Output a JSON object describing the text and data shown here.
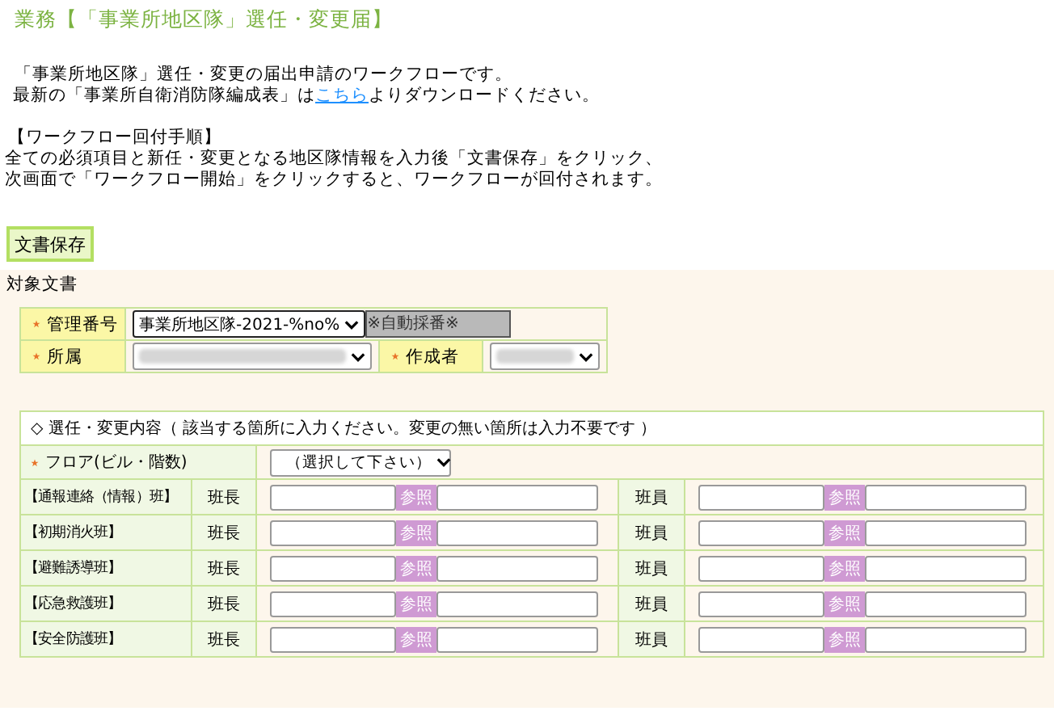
{
  "title": "業務【「事業所地区隊」選任・変更届】",
  "intro": [
    {
      "text": "「事業所地区隊」選任・変更の届出申請のワークフローです。"
    },
    {
      "before": "最新の「事業所自衛消防隊編成表」は",
      "link": "こちら",
      "after": "よりダウンロードください。"
    }
  ],
  "procedure": {
    "heading": "【ワークフロー回付手順】",
    "lines": [
      "全ての必須項目と新任・変更となる地区隊情報を入力後「文書保存」をクリック、",
      "次画面で「ワークフロー開始」をクリックすると、ワークフローが回付されます。"
    ]
  },
  "save_button": "文書保存",
  "section_label": "対象文書",
  "doc_fields": {
    "number": {
      "label": "管理番号",
      "required": true,
      "value": "事業所地区隊-2021-%no%",
      "auto": "※自動採番※"
    },
    "dept": {
      "label": "所属",
      "required": true,
      "redacted": true
    },
    "author": {
      "label": "作成者",
      "required": true,
      "redacted": true
    }
  },
  "changes": {
    "heading": "◇ 選任・変更内容（ 該当する箇所に入力ください。変更の無い箇所は入力不要です ）",
    "floor": {
      "label": "フロア(ビル・階数)",
      "required": true,
      "value": "（選択して下さい）"
    },
    "teams": [
      {
        "name": "【通報連絡（情報）班】",
        "leader_label": "班長",
        "leader_ref": "参照",
        "member_label": "班員",
        "member_ref": "参照"
      },
      {
        "name": "【初期消火班】",
        "leader_label": "班長",
        "leader_ref": "参照",
        "member_label": "班員",
        "member_ref": "参照"
      },
      {
        "name": "【避難誘導班】",
        "leader_label": "班長",
        "leader_ref": "参照",
        "member_label": "班員",
        "member_ref": "参照"
      },
      {
        "name": "【応急救護班】",
        "leader_label": "班長",
        "leader_ref": "参照",
        "member_label": "班員",
        "member_ref": "参照"
      },
      {
        "name": "【安全防護班】",
        "leader_label": "班長",
        "leader_ref": "参照",
        "member_label": "班員",
        "member_ref": "参照"
      }
    ]
  }
}
